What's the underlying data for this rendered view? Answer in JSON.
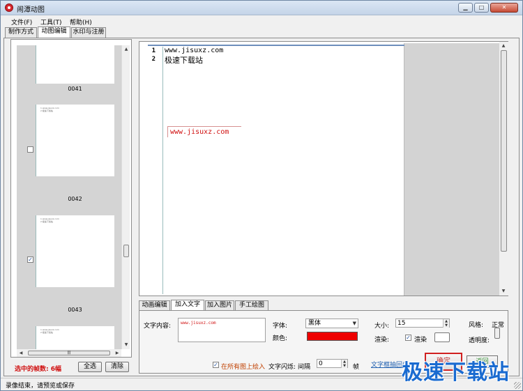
{
  "window": {
    "title": "闹潭动图",
    "minimize": "▁",
    "maximize": "□",
    "close": "✕"
  },
  "menu": [
    "文件(F)",
    "工具(T)",
    "帮助(H)"
  ],
  "tabs": [
    "制作方式",
    "动图编辑",
    "水印与注册"
  ],
  "frames": [
    {
      "label": "0041",
      "checked": false
    },
    {
      "label": "0042",
      "checked": false
    },
    {
      "label": "0043",
      "checked": true
    }
  ],
  "thumb_text": [
    "1  www.jisuxz.com",
    "2  极速下载站"
  ],
  "left_footer": {
    "selected": "选中的帧数: 6幅",
    "select_all": "全选",
    "clear": "清除"
  },
  "editor": {
    "lines": [
      {
        "num": "1",
        "text": "www.jisuxz.com"
      },
      {
        "num": "2",
        "text": "极速下载站"
      }
    ],
    "overlay": "www.jisuxz.com"
  },
  "bottom_tabs": [
    "动画编辑",
    "加入文字",
    "加入图片",
    "手工绘图"
  ],
  "text_settings": {
    "content_label": "文字内容:",
    "content_value": "www.jisuxz.com",
    "font_label": "字体:",
    "font_value": "黑体",
    "color_label": "颜色:",
    "color": "#ee0000",
    "size_label": "大小:",
    "size_value": "15",
    "render_label": "渲染:",
    "render_check_label": "渲染",
    "style_label": "风格:",
    "style_value": "正常",
    "opacity_label": "透明度:",
    "all_frames_label": "在所有图上绘入",
    "flash_label": "文字闪烁:",
    "interval_label": "间隔",
    "interval_value": "0",
    "frame_unit": "帧",
    "link_text": "文字框抽回(I)",
    "confirm": "确定",
    "return": "返回"
  },
  "status": "录像结束，请预览或保存",
  "watermark": "极速下载站"
}
